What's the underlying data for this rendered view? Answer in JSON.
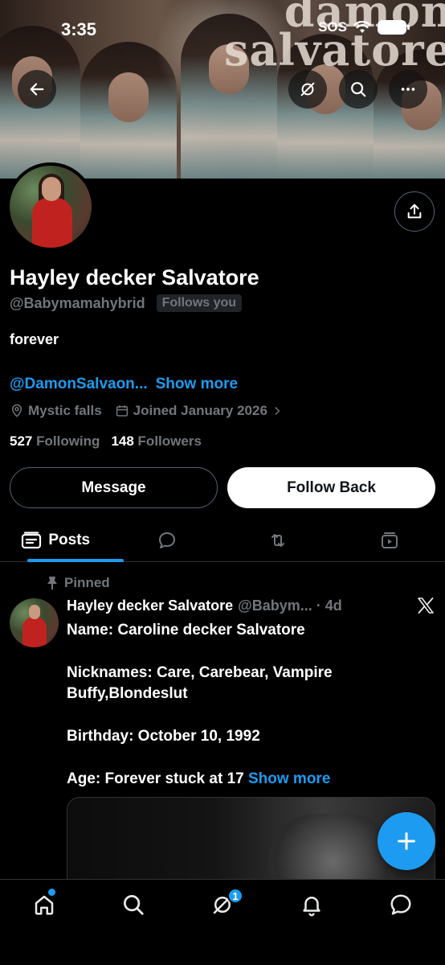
{
  "status_bar": {
    "time": "3:35",
    "sos": "SOS"
  },
  "banner": {
    "text_line1": "damon",
    "text_line2": "salvatore"
  },
  "profile": {
    "name": "Hayley decker Salvatore",
    "handle": "@Babymamahybrid",
    "follows_you": "Follows you",
    "bio": "forever",
    "bio_mention": "@DamonSalvaon...",
    "show_more": "Show more",
    "location": "Mystic falls",
    "joined": "Joined January 2026",
    "following_count": "527",
    "following_label": "Following",
    "followers_count": "148",
    "followers_label": "Followers"
  },
  "actions": {
    "message": "Message",
    "follow_back": "Follow Back"
  },
  "tabs": [
    {
      "label": "Posts",
      "icon": "posts-icon",
      "active": true
    },
    {
      "label": "",
      "icon": "replies-icon"
    },
    {
      "label": "",
      "icon": "retweet-icon"
    },
    {
      "label": "",
      "icon": "media-icon"
    }
  ],
  "post": {
    "pinned_label": "Pinned",
    "author_name": "Hayley decker Salvatore",
    "author_meta": "@Babym... · 4d",
    "lines": [
      "Name: Caroline decker Salvatore",
      "Nicknames: Care, Carebear, Vampire Buffy,Blondeslut",
      "Birthday: October 10, 1992",
      "Age: Forever stuck at 17"
    ],
    "show_more": "Show more"
  },
  "nav": {
    "notification_badge": "1"
  },
  "colors": {
    "accent": "#1d9bf0",
    "muted": "#71767b",
    "background": "#000000"
  }
}
